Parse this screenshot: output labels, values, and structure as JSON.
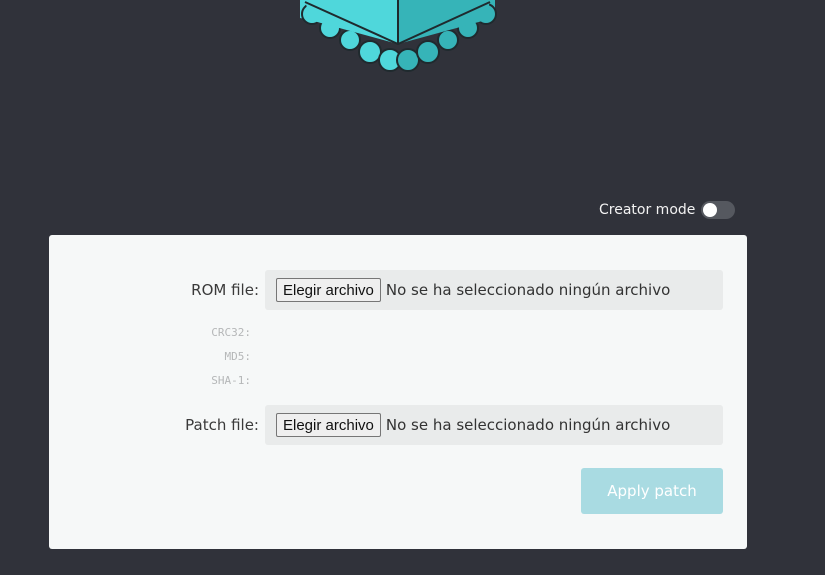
{
  "creator_mode": {
    "label": "Creator mode",
    "enabled": false
  },
  "rom": {
    "label": "ROM file:",
    "button": "Elegir archivo",
    "status": "No se ha seleccionado ningún archivo",
    "hashes": {
      "crc32": "CRC32:",
      "md5": "MD5:",
      "sha1": "SHA-1:"
    }
  },
  "patch": {
    "label": "Patch file:",
    "button": "Elegir archivo",
    "status": "No se ha seleccionado ningún archivo"
  },
  "apply_button": {
    "label": "Apply patch",
    "disabled": true
  },
  "colors": {
    "background": "#30323a",
    "logo_teal": "#4fd7db",
    "logo_dark": "#36b4b8",
    "panel": "#f6f8f8",
    "apply_disabled": "#a9dbe2"
  },
  "icons": {
    "logo": "rom-patcher-logo-icon"
  }
}
